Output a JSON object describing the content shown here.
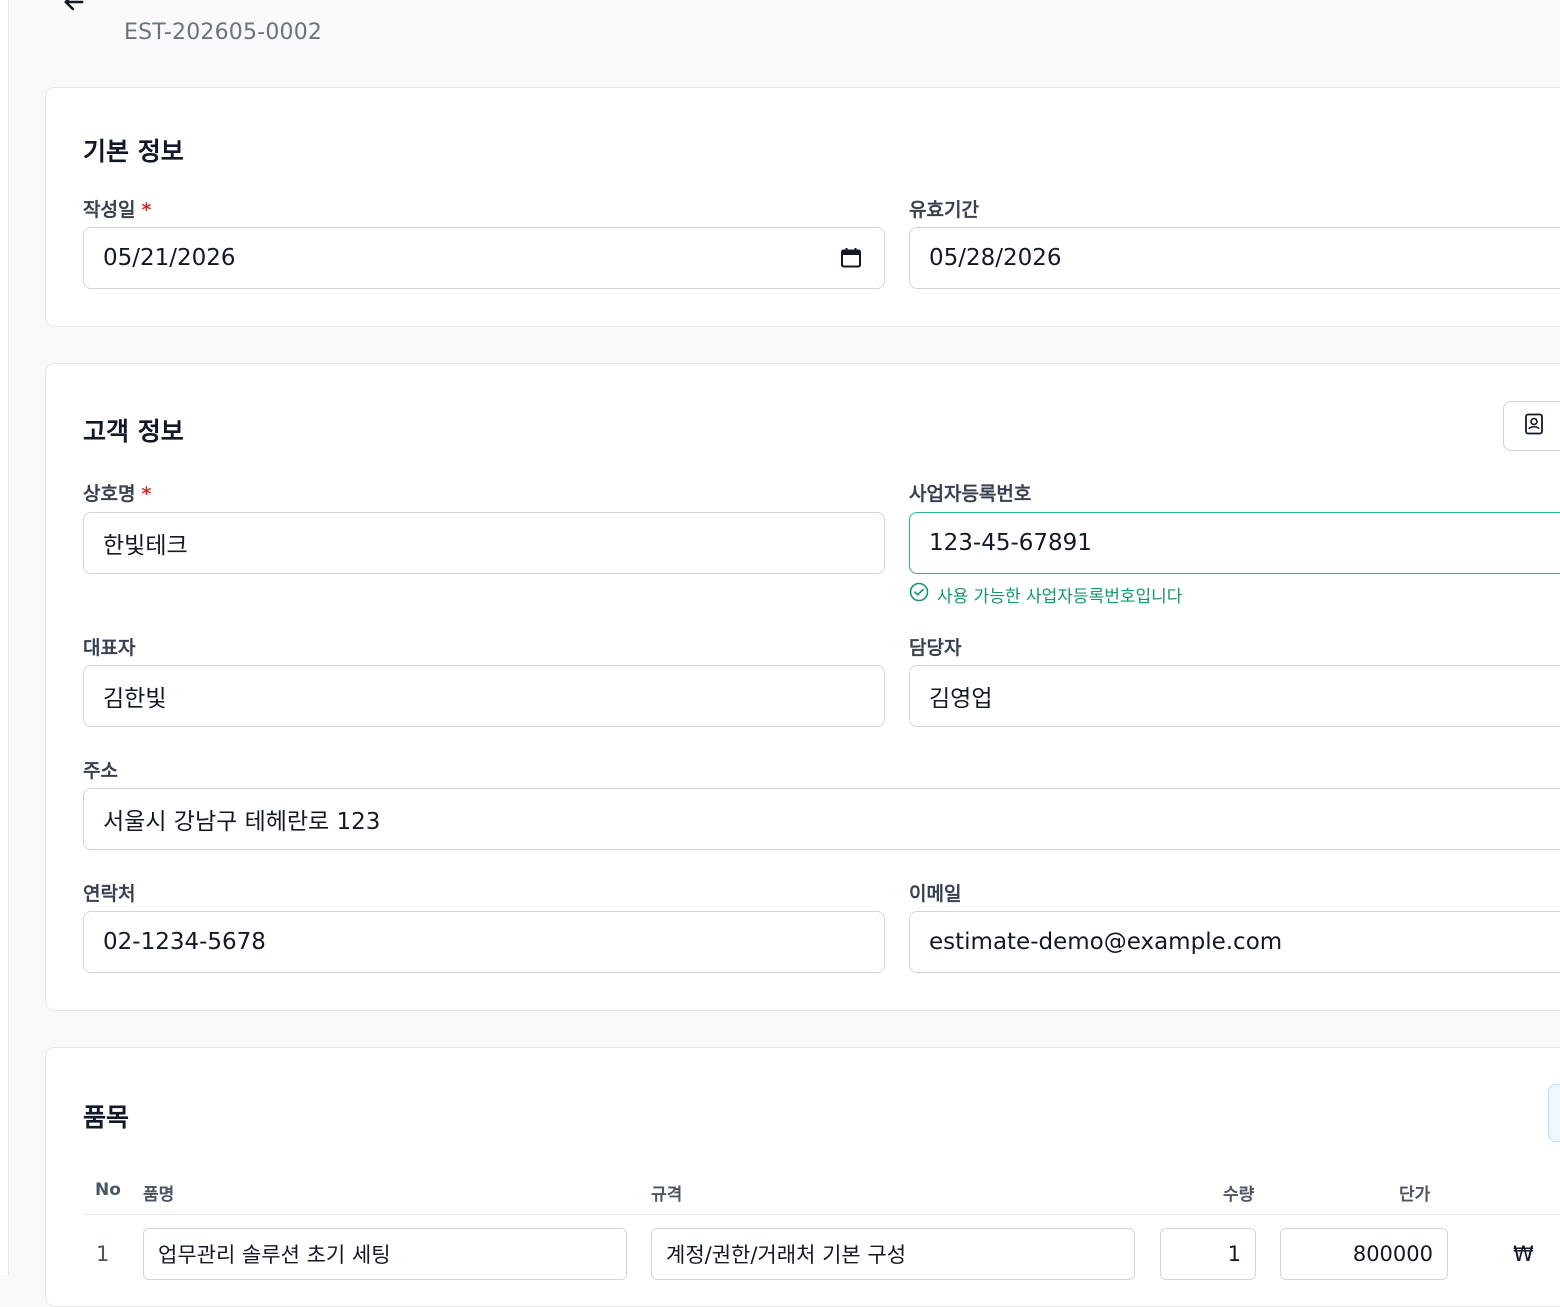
{
  "header": {
    "doc_number": "EST-202605-0002"
  },
  "basic_info": {
    "title": "기본 정보",
    "issue_date_label": "작성일",
    "issue_date_value": "05/21/2026",
    "valid_until_label": "유효기간",
    "valid_until_value": "05/28/2026",
    "required_mark": "*"
  },
  "customer_info": {
    "title": "고객 정보",
    "company_label": "상호명",
    "company_value": "한빛테크",
    "biz_no_label": "사업자등록번호",
    "biz_no_value": "123-45-67891",
    "biz_no_help": "사용 가능한 사업자등록번호입니다",
    "ceo_label": "대표자",
    "ceo_value": "김한빛",
    "manager_label": "담당자",
    "manager_value": "김영업",
    "address_label": "주소",
    "address_value": "서울시 강남구 테헤란로 123",
    "phone_label": "연락처",
    "phone_value": "02-1234-5678",
    "email_label": "이메일",
    "email_value": "estimate-demo@example.com",
    "required_mark": "*"
  },
  "items": {
    "title": "품목",
    "columns": {
      "no": "No",
      "name": "품명",
      "spec": "규격",
      "qty": "수량",
      "unit_price": "단가"
    },
    "rows": [
      {
        "no": "1",
        "name": "업무관리 솔루션 초기 세팅",
        "spec": "계정/권한/거래처 기본 구성",
        "qty": "1",
        "unit_price": "800000",
        "currency": "₩"
      }
    ]
  },
  "colors": {
    "accent_valid": "#2bb58a",
    "required": "#dc2626"
  }
}
